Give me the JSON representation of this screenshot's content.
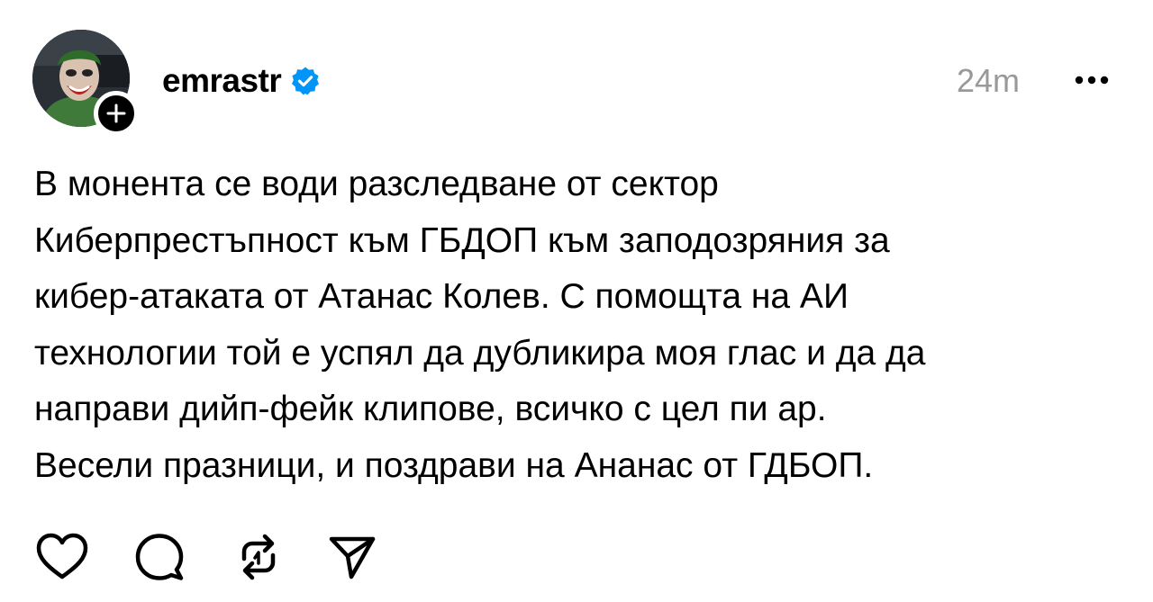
{
  "post": {
    "author": {
      "username": "emrastr",
      "verified": true,
      "avatar": "avatar-photo",
      "follow_icon": "plus-icon"
    },
    "timestamp": "24m",
    "more_icon": "more-icon",
    "text_lines": [
      "В монента се води разследване от сектор",
      "Киберпрестъпност към ГБДОП към заподозряния за",
      "кибер-атаката от Атанас Колев. С помощта на АИ",
      "технологии той е успял да дубликира моя глас и да да",
      "направи дийп-фейк клипове, всичко с цел пи ар.",
      "Весели празници, и поздрави на Ананас от ГДБОП."
    ]
  },
  "actions": {
    "like_icon": "heart-icon",
    "reply_icon": "comment-icon",
    "repost_icon": "repost-icon",
    "share_icon": "send-icon"
  },
  "colors": {
    "text": "#000000",
    "muted": "#999999",
    "verified": "#0095f6",
    "background": "#ffffff"
  }
}
